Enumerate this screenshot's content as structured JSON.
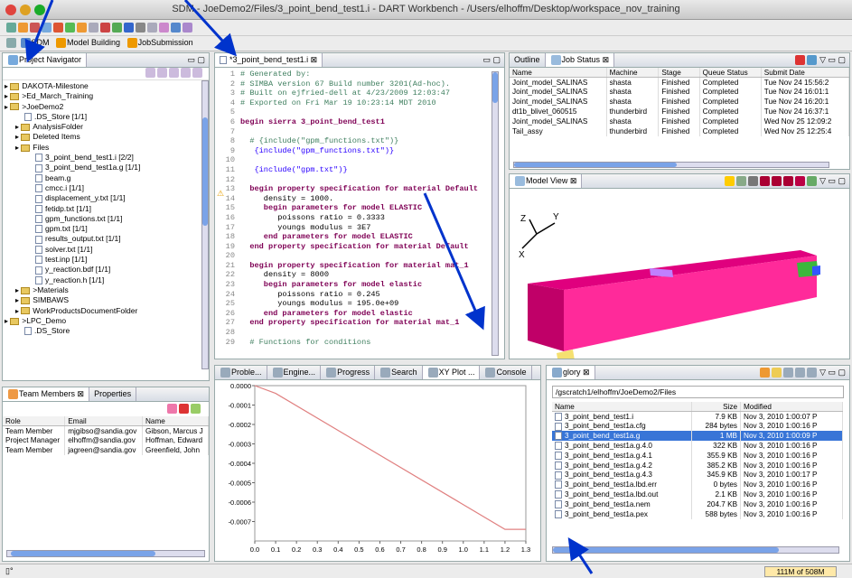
{
  "window": {
    "title": "SDM - JoeDemo2/Files/3_point_bend_test1.i - DART Workbench - /Users/elhoffm/Desktop/workspace_nov_training"
  },
  "perspectives": [
    {
      "label": "SDM"
    },
    {
      "label": "Model Building"
    },
    {
      "label": "JobSubmission"
    }
  ],
  "navigator": {
    "tab": "Project Navigator",
    "items": [
      {
        "label": "DAKOTA-Milestone",
        "indent": 0,
        "type": "folder"
      },
      {
        "label": ">Ed_March_Training",
        "indent": 0,
        "type": "folder"
      },
      {
        "label": ">JoeDemo2",
        "indent": 0,
        "type": "folder"
      },
      {
        "label": ".DS_Store [1/1]",
        "indent": 1,
        "type": "file"
      },
      {
        "label": "AnalysisFolder",
        "indent": 1,
        "type": "folder"
      },
      {
        "label": "Deleted Items",
        "indent": 1,
        "type": "folder"
      },
      {
        "label": "Files",
        "indent": 1,
        "type": "folder"
      },
      {
        "label": "3_point_bend_test1.i [2/2]",
        "indent": 2,
        "type": "file"
      },
      {
        "label": "3_point_bend_test1a.g [1/1]",
        "indent": 2,
        "type": "file"
      },
      {
        "label": "beam.g",
        "indent": 2,
        "type": "file"
      },
      {
        "label": "cmcc.i [1/1]",
        "indent": 2,
        "type": "file"
      },
      {
        "label": "displacement_y.txt [1/1]",
        "indent": 2,
        "type": "file"
      },
      {
        "label": "fetidp.txt [1/1]",
        "indent": 2,
        "type": "file"
      },
      {
        "label": "gpm_functions.txt [1/1]",
        "indent": 2,
        "type": "file"
      },
      {
        "label": "gpm.txt [1/1]",
        "indent": 2,
        "type": "file"
      },
      {
        "label": "results_output.txt [1/1]",
        "indent": 2,
        "type": "file"
      },
      {
        "label": "solver.txt [1/1]",
        "indent": 2,
        "type": "file"
      },
      {
        "label": "test.inp [1/1]",
        "indent": 2,
        "type": "file"
      },
      {
        "label": "y_reaction.bdf [1/1]",
        "indent": 2,
        "type": "file"
      },
      {
        "label": "y_reaction.h [1/1]",
        "indent": 2,
        "type": "file"
      },
      {
        "label": ">Materials",
        "indent": 1,
        "type": "folder"
      },
      {
        "label": "SIMBAWS",
        "indent": 1,
        "type": "folder"
      },
      {
        "label": "WorkProductsDocumentFolder",
        "indent": 1,
        "type": "folder"
      },
      {
        "label": ">LPC_Demo",
        "indent": 0,
        "type": "folder"
      },
      {
        "label": ".DS_Store",
        "indent": 1,
        "type": "file"
      }
    ]
  },
  "team": {
    "tabs": [
      "Team Members",
      "Properties"
    ],
    "columns": [
      "Role",
      "Email",
      "Name"
    ],
    "rows": [
      [
        "Team Member",
        "mjgibso@sandia.gov",
        "Gibson, Marcus J"
      ],
      [
        "Project Manager",
        "elhoffm@sandia.gov",
        "Hoffman, Edward"
      ],
      [
        "Team Member",
        "jagreen@sandia.gov",
        "Greenfield, John"
      ]
    ]
  },
  "editor": {
    "tab": "*3_point_bend_test1.i",
    "lines": [
      {
        "n": "1",
        "t": "# Generated by:",
        "c": "cmt"
      },
      {
        "n": "2",
        "t": "# SIMBA version 67 Build number 3201(Ad-hoc).",
        "c": "cmt"
      },
      {
        "n": "3",
        "t": "# Built on ejfried-dell at 4/23/2009 12:03:47",
        "c": "cmt"
      },
      {
        "n": "4",
        "t": "# Exported on Fri Mar 19 10:23:14 MDT 2010",
        "c": "cmt"
      },
      {
        "n": "5",
        "t": "",
        "c": ""
      },
      {
        "n": "6",
        "t": "begin sierra 3_point_bend_test1",
        "c": "kw"
      },
      {
        "n": "7",
        "t": "",
        "c": ""
      },
      {
        "n": "8",
        "t": "  # {include(\"gpm_functions.txt\")}",
        "c": "cmt"
      },
      {
        "n": "9",
        "t": "   {include(\"gpm_functions.txt\")}",
        "c": "str"
      },
      {
        "n": "10",
        "t": "",
        "c": ""
      },
      {
        "n": "11",
        "t": "   {include(\"gpm.txt\")}",
        "c": "str"
      },
      {
        "n": "12",
        "t": "",
        "c": ""
      },
      {
        "n": "13",
        "t": "  begin property specification for material Default",
        "c": "kw"
      },
      {
        "n": "14",
        "t": "     density = 1000.",
        "c": ""
      },
      {
        "n": "15",
        "t": "     begin parameters for model ELASTIC",
        "c": "kw"
      },
      {
        "n": "16",
        "t": "        poissons ratio = 0.3333",
        "c": ""
      },
      {
        "n": "17",
        "t": "        youngs modulus = 3E7",
        "c": ""
      },
      {
        "n": "18",
        "t": "     end parameters for model ELASTIC",
        "c": "kw"
      },
      {
        "n": "19",
        "t": "  end property specification for material Default",
        "c": "kw"
      },
      {
        "n": "20",
        "t": "",
        "c": ""
      },
      {
        "n": "21",
        "t": "  begin property specification for material mat_1",
        "c": "kw"
      },
      {
        "n": "22",
        "t": "     density = 8000",
        "c": ""
      },
      {
        "n": "23",
        "t": "     begin parameters for model elastic",
        "c": "kw"
      },
      {
        "n": "24",
        "t": "        poissons ratio = 0.245",
        "c": ""
      },
      {
        "n": "25",
        "t": "        youngs modulus = 195.0e+09",
        "c": ""
      },
      {
        "n": "26",
        "t": "     end parameters for model elastic",
        "c": "kw"
      },
      {
        "n": "27",
        "t": "  end property specification for material mat_1",
        "c": "kw"
      },
      {
        "n": "28",
        "t": "",
        "c": ""
      },
      {
        "n": "29",
        "t": "  # Functions for conditions",
        "c": "cmt"
      }
    ]
  },
  "outline": {
    "tabs": [
      "Outline",
      "Job Status"
    ],
    "columns": [
      "Name",
      "Machine",
      "Stage",
      "Queue Status",
      "Submit Date"
    ],
    "rows": [
      [
        "Joint_model_SALINAS",
        "shasta",
        "Finished",
        "Completed",
        "Tue Nov 24 15:56:2"
      ],
      [
        "Joint_model_SALINAS",
        "shasta",
        "Finished",
        "Completed",
        "Tue Nov 24 16:01:1"
      ],
      [
        "Joint_model_SALINAS",
        "shasta",
        "Finished",
        "Completed",
        "Tue Nov 24 16:20:1"
      ],
      [
        "dt1b_blivet_060515",
        "thunderbird",
        "Finished",
        "Completed",
        "Tue Nov 24 16:37:1"
      ],
      [
        "Joint_model_SALINAS",
        "shasta",
        "Finished",
        "Completed",
        "Wed Nov 25 12:09:2"
      ],
      [
        "Tail_assy",
        "thunderbird",
        "Finished",
        "Completed",
        "Wed Nov 25 12:25:4"
      ]
    ]
  },
  "model_view": {
    "tab": "Model View",
    "axis_x": "X",
    "axis_y": "Y",
    "axis_z": "Z"
  },
  "bottom_tabs": [
    "Proble...",
    "Engine...",
    "Progress",
    "Search",
    "XY Plot ...",
    "Console"
  ],
  "xyplot": {
    "yticks": [
      "0.0000",
      "-0.0001",
      "-0.0002",
      "-0.0003",
      "-0.0004",
      "-0.0005",
      "-0.0006",
      "-0.0007"
    ],
    "xticks": [
      "0.0",
      "0.1",
      "0.2",
      "0.3",
      "0.4",
      "0.5",
      "0.6",
      "0.7",
      "0.8",
      "0.9",
      "1.0",
      "1.1",
      "1.2",
      "1.3"
    ]
  },
  "chart_data": {
    "type": "line",
    "x": [
      0.0,
      0.1,
      1.2,
      1.3
    ],
    "y": [
      0.0,
      -4e-05,
      -0.00074,
      -0.00074
    ],
    "xlim": [
      0,
      1.3
    ],
    "ylim": [
      -0.0008,
      0.0
    ],
    "color": "#e08080"
  },
  "glory": {
    "tab": "glory",
    "path": "/gscratch1/elhoffm/JoeDemo2/Files",
    "columns": [
      "Name",
      "Size",
      "Modified"
    ],
    "rows": [
      [
        "3_point_bend_test1.i",
        "7.9 KB",
        "Nov 3, 2010 1:00:07 P"
      ],
      [
        "3_point_bend_test1a.cfg",
        "284 bytes",
        "Nov 3, 2010 1:00:16 P"
      ],
      [
        "3_point_bend_test1a.g",
        "1 MB",
        "Nov 3, 2010 1:00:09 P"
      ],
      [
        "3_point_bend_test1a.g.4.0",
        "322 KB",
        "Nov 3, 2010 1:00:16 P"
      ],
      [
        "3_point_bend_test1a.g.4.1",
        "355.9 KB",
        "Nov 3, 2010 1:00:16 P"
      ],
      [
        "3_point_bend_test1a.g.4.2",
        "385.2 KB",
        "Nov 3, 2010 1:00:16 P"
      ],
      [
        "3_point_bend_test1a.g.4.3",
        "345.9 KB",
        "Nov 3, 2010 1:00:17 P"
      ],
      [
        "3_point_bend_test1a.lbd.err",
        "0 bytes",
        "Nov 3, 2010 1:00:16 P"
      ],
      [
        "3_point_bend_test1a.lbd.out",
        "2.1 KB",
        "Nov 3, 2010 1:00:16 P"
      ],
      [
        "3_point_bend_test1a.nem",
        "204.7 KB",
        "Nov 3, 2010 1:00:16 P"
      ],
      [
        "3_point_bend_test1a.pex",
        "588 bytes",
        "Nov 3, 2010 1:00:16 P"
      ]
    ]
  },
  "status": {
    "memory": "111M of 508M"
  }
}
